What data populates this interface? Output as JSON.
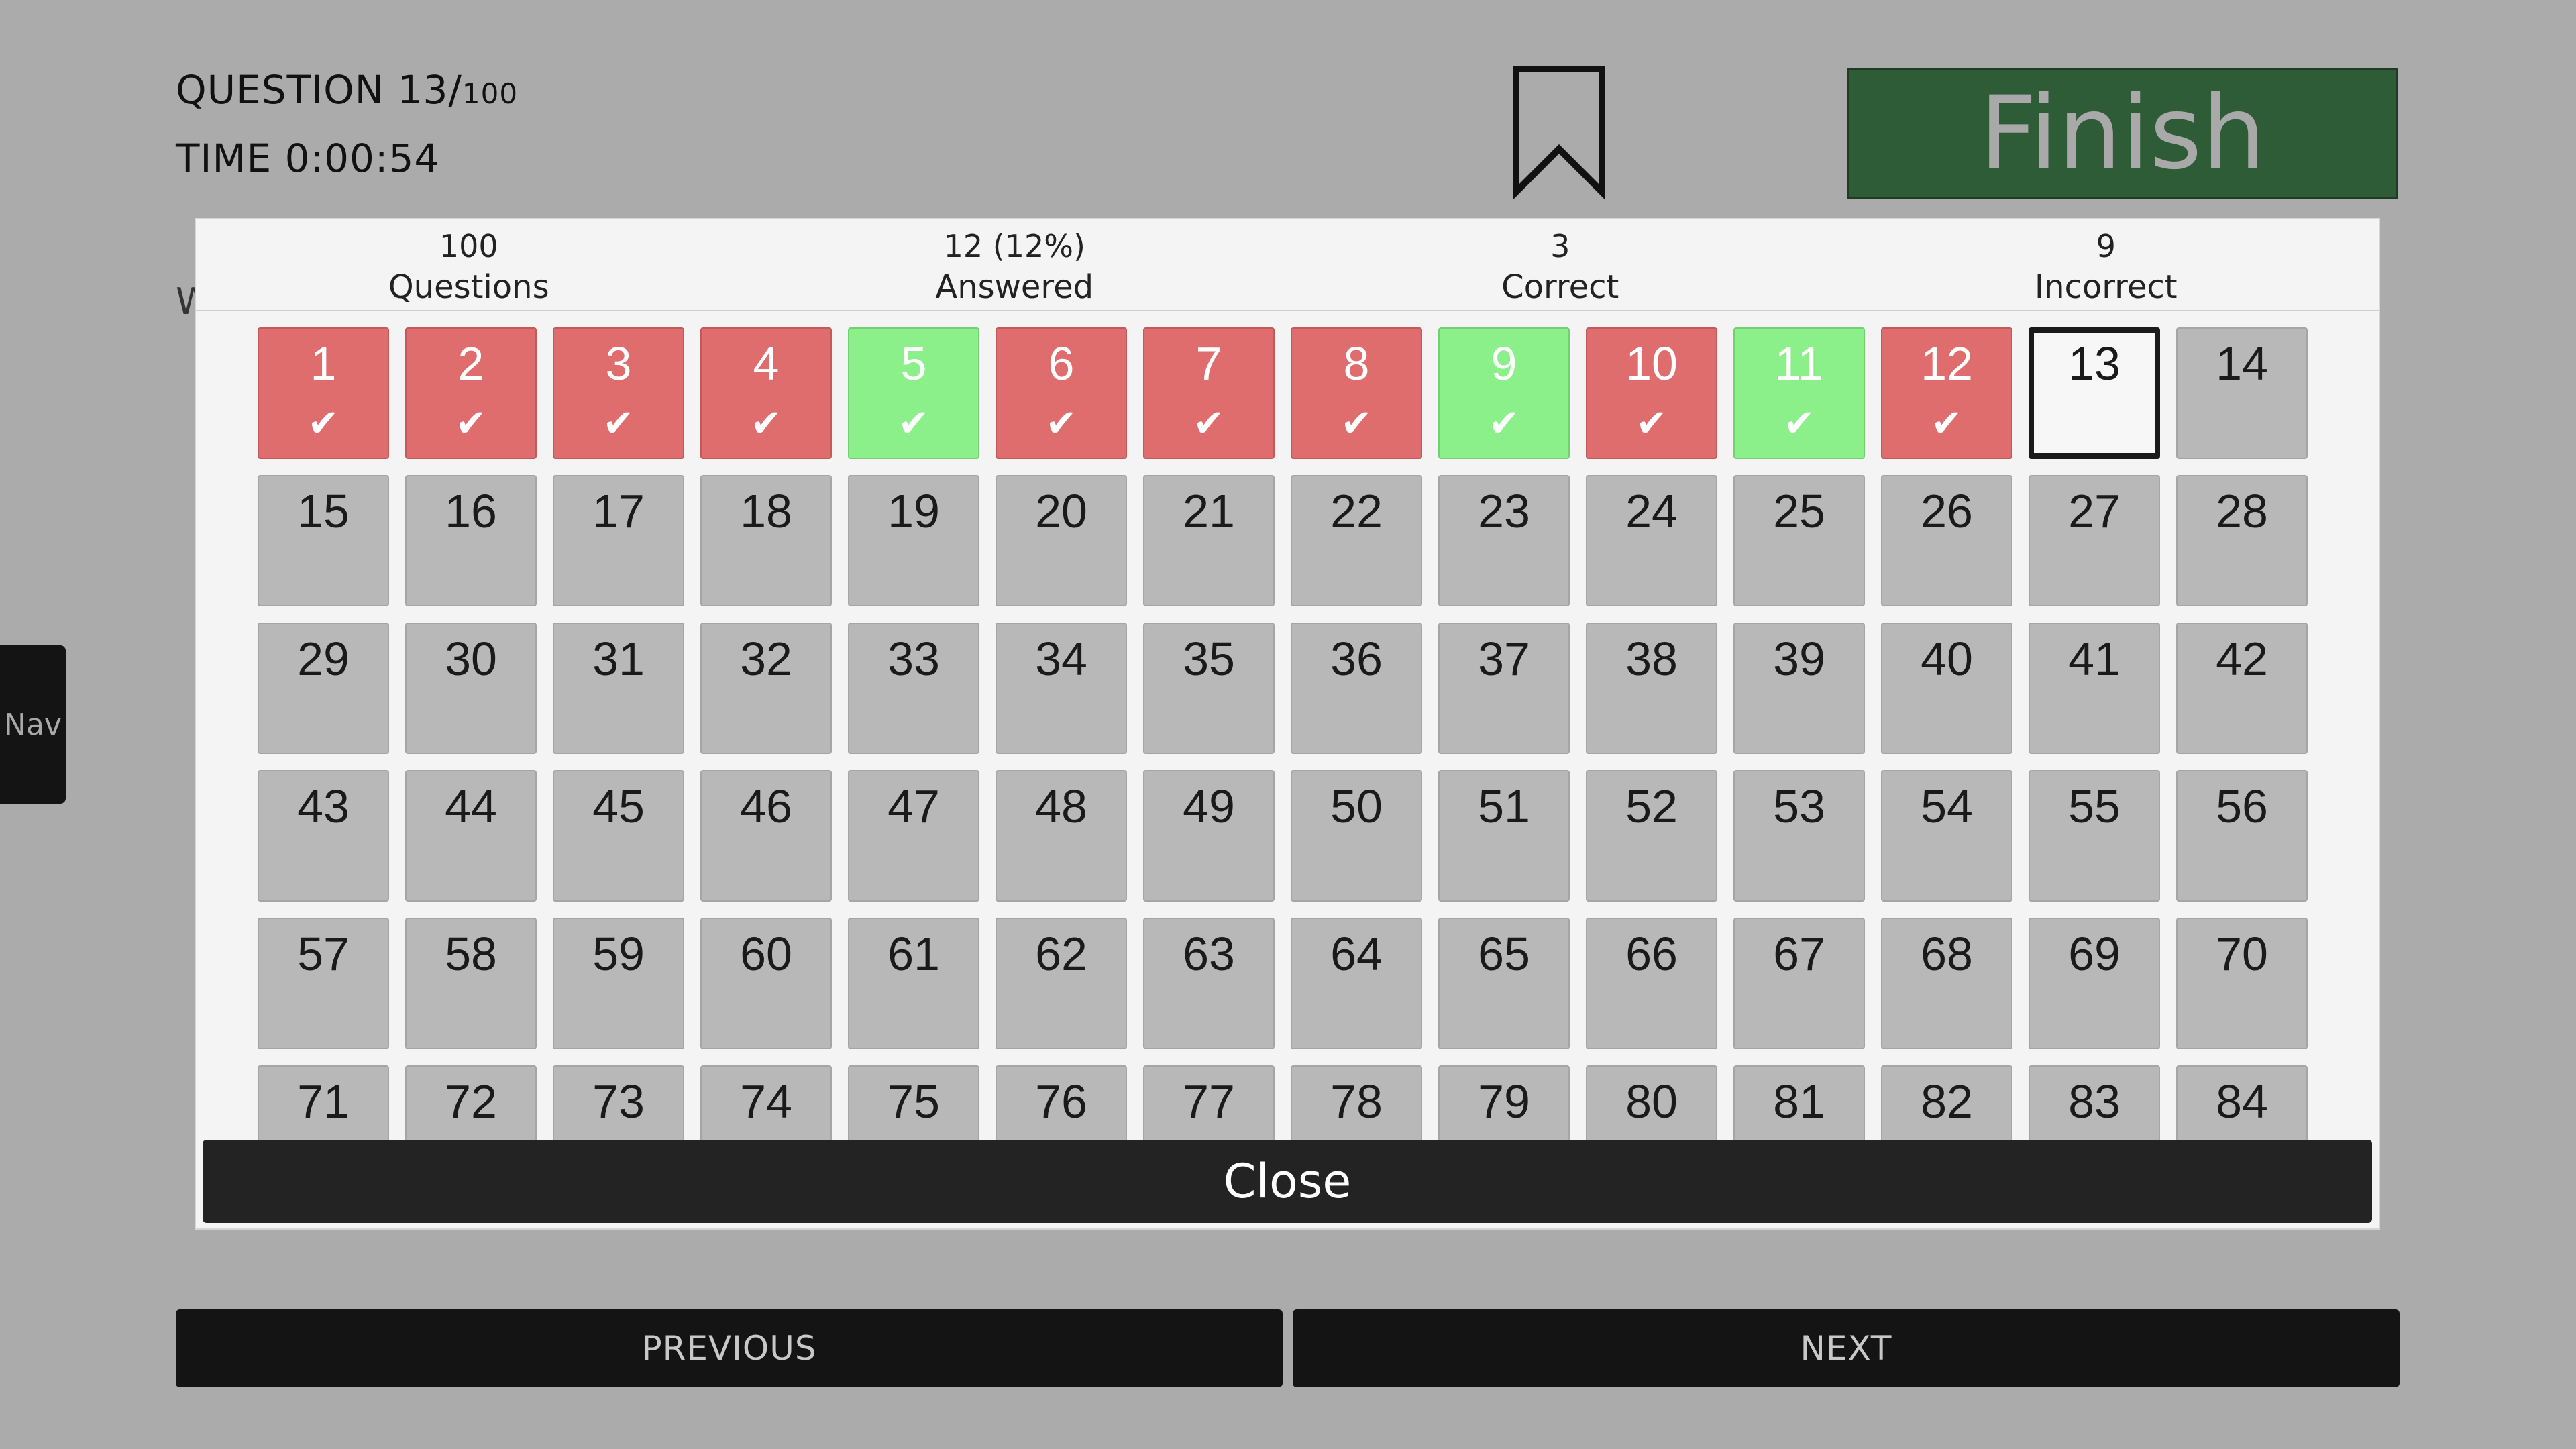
{
  "header": {
    "question_label": "QUESTION 13/",
    "question_total": "100",
    "time_label": "TIME 0:00:54",
    "bookmark_icon": "bookmark-icon",
    "finish_label": "Finish"
  },
  "side": {
    "nav_label": "Nav"
  },
  "stats": [
    {
      "value": "100",
      "label": "Questions"
    },
    {
      "value": "12 (12%)",
      "label": "Answered"
    },
    {
      "value": "3",
      "label": "Correct"
    },
    {
      "value": "9",
      "label": "Incorrect"
    }
  ],
  "grid": {
    "current": 13,
    "correct": [
      5,
      9,
      11
    ],
    "incorrect": [
      1,
      2,
      3,
      4,
      6,
      7,
      8,
      10,
      12
    ],
    "visible_numbers": [
      "1",
      "2",
      "3",
      "4",
      "5",
      "6",
      "7",
      "8",
      "9",
      "10",
      "11",
      "12",
      "13",
      "14",
      "15",
      "16",
      "17",
      "18",
      "19",
      "20",
      "21",
      "22",
      "23",
      "24",
      "25",
      "26",
      "27",
      "28",
      "29",
      "30",
      "31",
      "32",
      "33",
      "34",
      "35",
      "36",
      "37",
      "38",
      "39",
      "40",
      "41",
      "42",
      "43",
      "44",
      "45",
      "46",
      "47",
      "48",
      "49",
      "50",
      "51",
      "52",
      "53",
      "54",
      "55",
      "56",
      "57",
      "58",
      "59",
      "60",
      "61",
      "62",
      "63",
      "64",
      "65",
      "66",
      "67",
      "68",
      "69",
      "70",
      "71",
      "72",
      "73",
      "74",
      "75",
      "76",
      "77",
      "78",
      "79",
      "80",
      "81",
      "82",
      "83",
      "84"
    ],
    "checkmark": "✔"
  },
  "modal": {
    "close_label": "Close"
  },
  "footer": {
    "previous_label": "PREVIOUS",
    "next_label": "NEXT"
  },
  "colors": {
    "background": "#ababab",
    "finish": "#2e5c37",
    "incorrect": "#e06d6d",
    "correct": "#8cf08a",
    "unanswered": "#b8b8b8"
  }
}
